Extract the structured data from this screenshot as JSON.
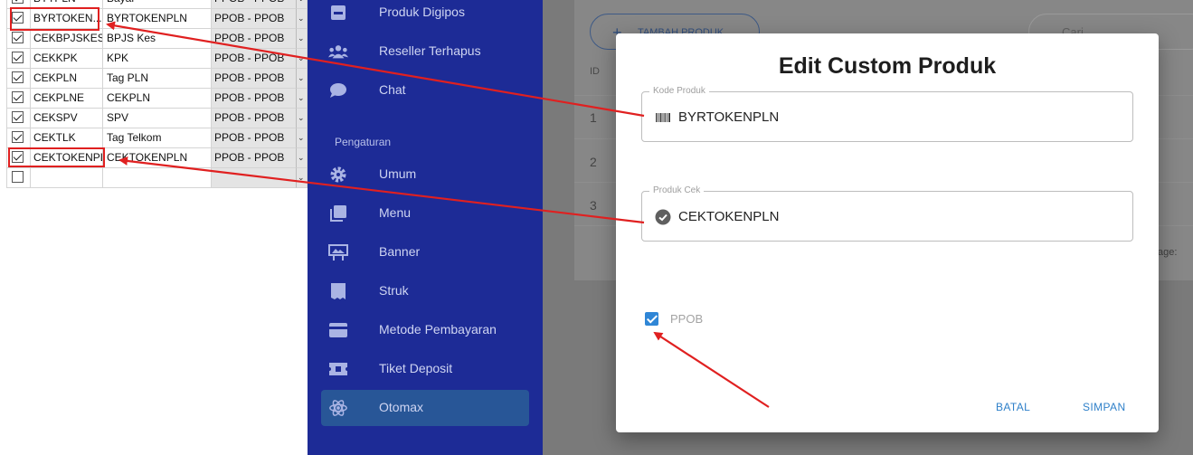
{
  "sheet": {
    "rows": [
      {
        "checked": true,
        "code": "BYTPLN",
        "name": "Bayar",
        "category": "PPOB - PPOB"
      },
      {
        "checked": true,
        "code": "BYRTOKEN...",
        "name": "BYRTOKENPLN",
        "category": "PPOB - PPOB"
      },
      {
        "checked": true,
        "code": "CEKBPJSKES",
        "name": "BPJS Kes",
        "category": "PPOB - PPOB"
      },
      {
        "checked": true,
        "code": "CEKKPK",
        "name": "KPK",
        "category": "PPOB - PPOB"
      },
      {
        "checked": true,
        "code": "CEKPLN",
        "name": "Tag PLN",
        "category": "PPOB - PPOB"
      },
      {
        "checked": true,
        "code": "CEKPLNE",
        "name": "CEKPLN",
        "category": "PPOB - PPOB"
      },
      {
        "checked": true,
        "code": "CEKSPV",
        "name": "SPV",
        "category": "PPOB - PPOB"
      },
      {
        "checked": true,
        "code": "CEKTLK",
        "name": "Tag Telkom",
        "category": "PPOB - PPOB"
      },
      {
        "checked": true,
        "code": "CEKTOKENPLN",
        "name": "CEKTOKENPLN",
        "category": "PPOB - PPOB"
      },
      {
        "checked": false,
        "code": "",
        "name": "",
        "category": ""
      }
    ]
  },
  "sidebar": {
    "items": [
      {
        "label": "Produk Digipos",
        "icon": "box-icon"
      },
      {
        "label": "Reseller Terhapus",
        "icon": "users-icon"
      },
      {
        "label": "Chat",
        "icon": "chat-bubble-icon"
      }
    ],
    "section": "Pengaturan",
    "settings": [
      {
        "label": "Umum",
        "icon": "gear-icon"
      },
      {
        "label": "Menu",
        "icon": "layers-icon"
      },
      {
        "label": "Banner",
        "icon": "banner-icon"
      },
      {
        "label": "Struk",
        "icon": "receipt-icon"
      },
      {
        "label": "Metode Pembayaran",
        "icon": "card-icon"
      },
      {
        "label": "Tiket Deposit",
        "icon": "ticket-icon"
      },
      {
        "label": "Otomax",
        "icon": "atom-icon"
      }
    ]
  },
  "main": {
    "add_button": "TAMBAH PRODUK",
    "search_placeholder": "Cari",
    "col_id": "ID",
    "rows": [
      "1",
      "2",
      "3"
    ],
    "page_label": "age:"
  },
  "dialog": {
    "title": "Edit Custom Produk",
    "kode_label": "Kode Produk",
    "kode_value": "BYRTOKENPLN",
    "cek_label": "Produk Cek",
    "cek_value": "CEKTOKENPLN",
    "checkbox_label": "PPOB",
    "checkbox_checked": true,
    "cancel": "BATAL",
    "save": "SIMPAN"
  },
  "colors": {
    "sidebar": "#1d2b96",
    "active_item": "#285697",
    "accent": "#2f80c9",
    "annotation": "#e02020"
  }
}
